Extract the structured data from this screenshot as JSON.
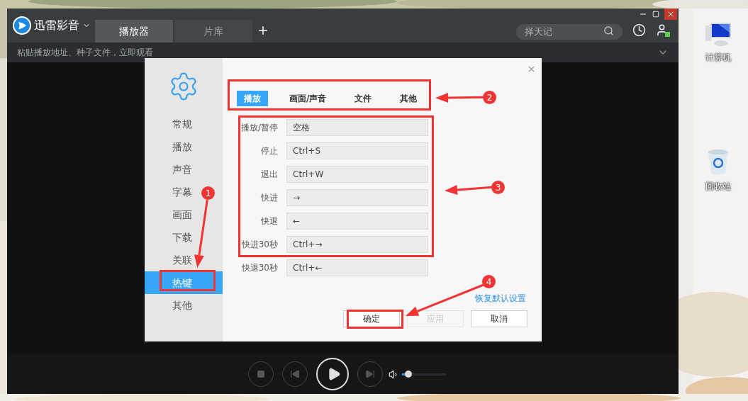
{
  "app": {
    "title": "迅雷影音",
    "tabs": [
      {
        "label": "播放器",
        "selected": true
      },
      {
        "label": "片库",
        "selected": false
      }
    ],
    "search": {
      "placeholder": "择天记"
    },
    "address_bar": {
      "placeholder": "粘贴播放地址、种子文件，立即观看"
    }
  },
  "dialog": {
    "sidebar": [
      {
        "label": "常规",
        "selected": false
      },
      {
        "label": "播放",
        "selected": false
      },
      {
        "label": "声音",
        "selected": false
      },
      {
        "label": "字幕",
        "selected": false
      },
      {
        "label": "画面",
        "selected": false
      },
      {
        "label": "下载",
        "selected": false
      },
      {
        "label": "关联",
        "selected": false
      },
      {
        "label": "热键",
        "selected": true
      },
      {
        "label": "其他",
        "selected": false
      }
    ],
    "tabs": [
      {
        "label": "播放",
        "selected": true
      },
      {
        "label": "画面/声音",
        "selected": false
      },
      {
        "label": "文件",
        "selected": false
      },
      {
        "label": "其他",
        "selected": false
      }
    ],
    "hotkeys": [
      {
        "label": "播放/暂停",
        "value": "空格"
      },
      {
        "label": "停止",
        "value": "Ctrl+S"
      },
      {
        "label": "退出",
        "value": "Ctrl+W"
      },
      {
        "label": "快进",
        "value": "→"
      },
      {
        "label": "快退",
        "value": "←"
      },
      {
        "label": "快进30秒",
        "value": "Ctrl+→"
      },
      {
        "label": "快退30秒",
        "value": "Ctrl+←"
      }
    ],
    "restore_link": "恢复默认设置",
    "buttons": [
      {
        "label": "确定",
        "disabled": false
      },
      {
        "label": "应用",
        "disabled": true
      },
      {
        "label": "取消",
        "disabled": false
      }
    ]
  },
  "player": {
    "volume": {
      "level": 0.15
    }
  },
  "desktop_icons": [
    {
      "kind": "computer",
      "label": "计算机"
    },
    {
      "kind": "recycle-bin",
      "label": "回收站"
    }
  ],
  "annotations": [
    {
      "number": "1"
    },
    {
      "number": "2"
    },
    {
      "number": "3"
    },
    {
      "number": "4"
    }
  ]
}
